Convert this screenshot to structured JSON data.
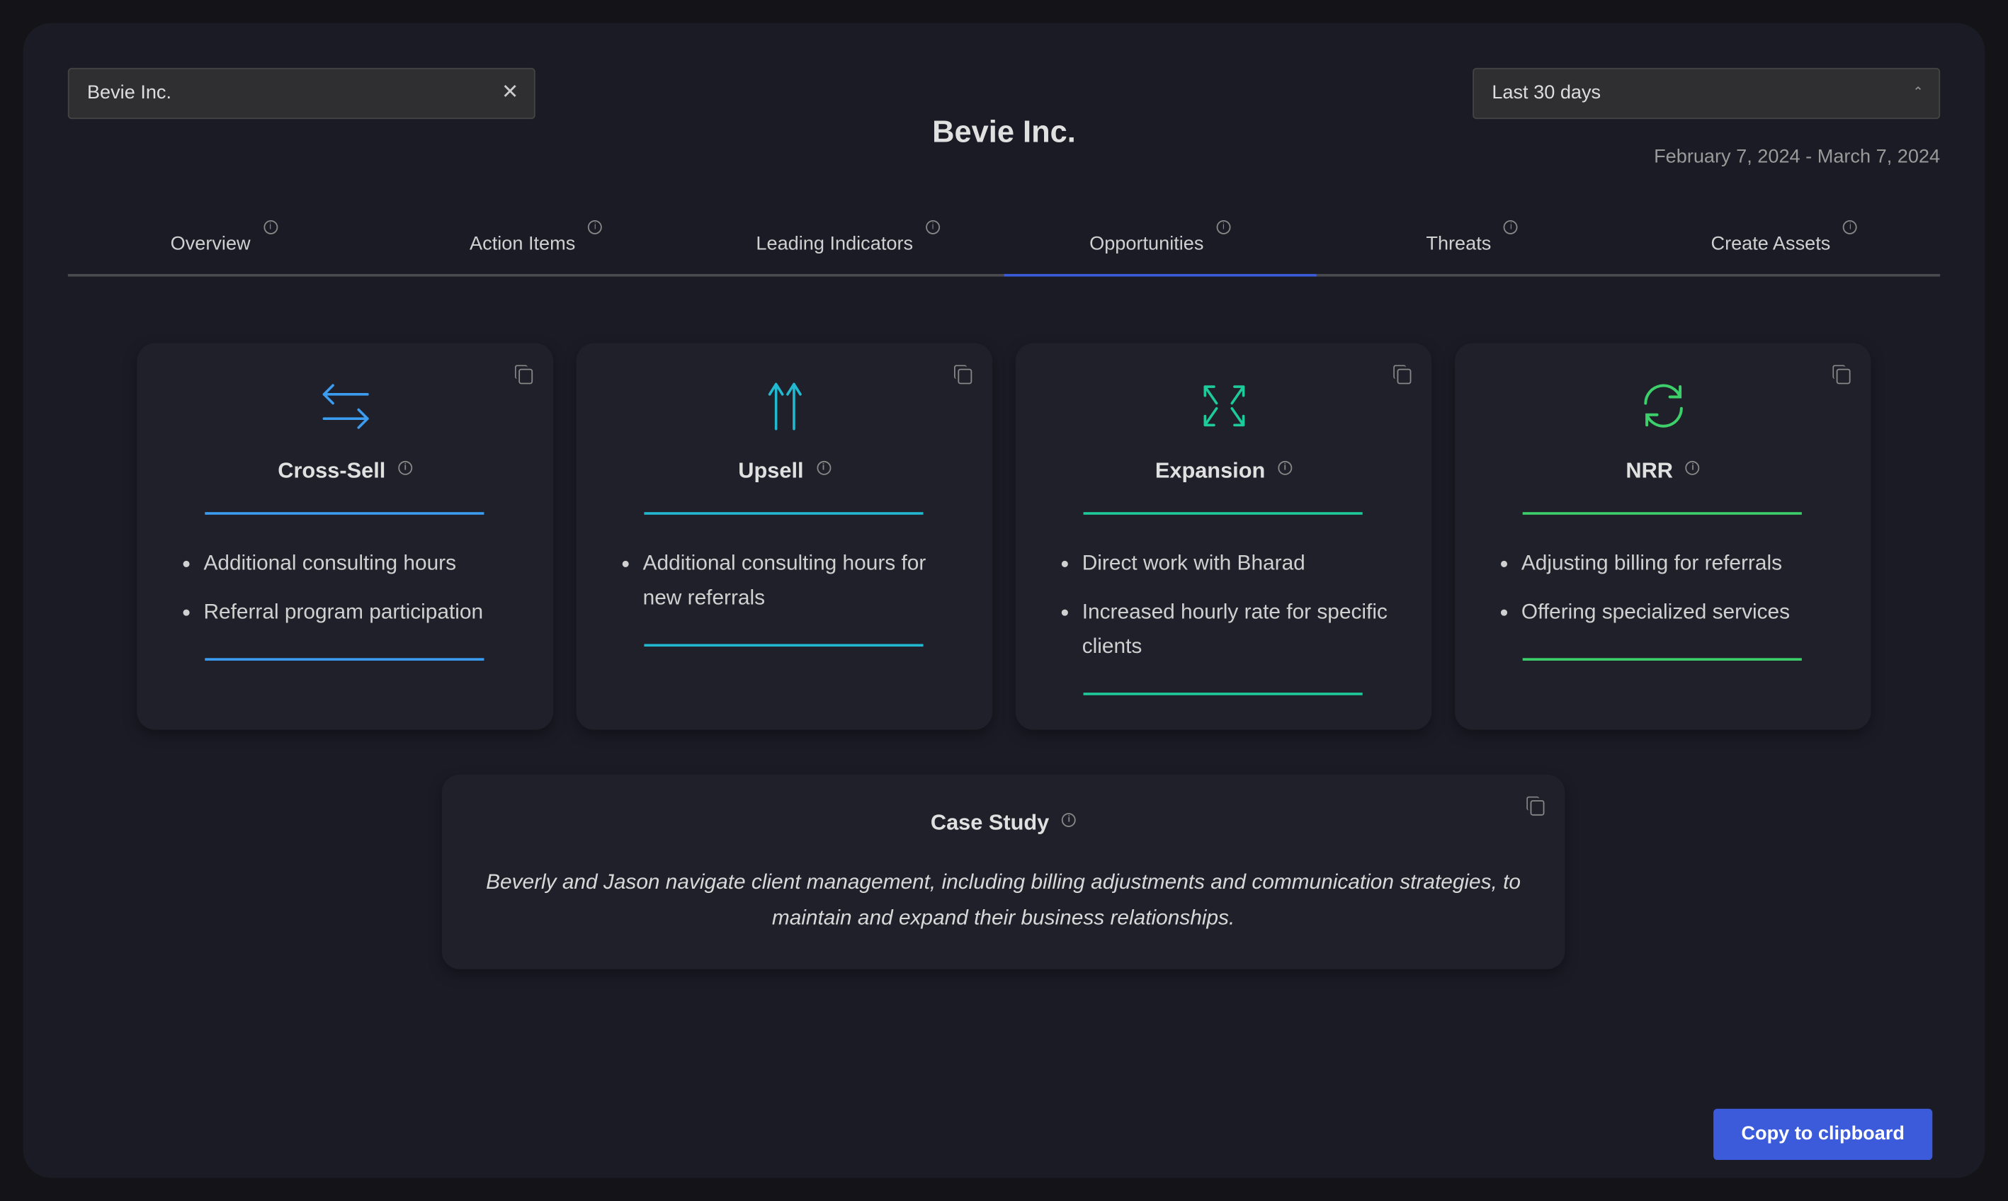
{
  "search": {
    "value": "Bevie Inc."
  },
  "date_range": {
    "selected": "Last 30 days",
    "dates": "February 7, 2024 - March 7, 2024"
  },
  "page_title": "Bevie Inc.",
  "tabs": [
    {
      "label": "Overview"
    },
    {
      "label": "Action Items"
    },
    {
      "label": "Leading Indicators"
    },
    {
      "label": "Opportunities",
      "active": true
    },
    {
      "label": "Threats"
    },
    {
      "label": "Create Assets"
    }
  ],
  "colors": {
    "cross_sell": "#3b9cf0",
    "upsell": "#22b8d0",
    "expansion": "#1ec99a",
    "nrr": "#3ccf6a",
    "accent": "#3b5bdb"
  },
  "cards": [
    {
      "title": "Cross-Sell",
      "icon": "arrows-left-right-icon",
      "items": [
        "Additional consulting hours",
        "Referral program participation"
      ]
    },
    {
      "title": "Upsell",
      "icon": "double-arrow-up-icon",
      "items": [
        "Additional consulting hours for new referrals"
      ]
    },
    {
      "title": "Expansion",
      "icon": "expand-arrows-icon",
      "items": [
        "Direct work with Bharad",
        "Increased hourly rate for specific clients"
      ]
    },
    {
      "title": "NRR",
      "icon": "refresh-icon",
      "items": [
        "Adjusting billing for referrals",
        "Offering specialized services"
      ]
    }
  ],
  "case_study": {
    "title": "Case Study",
    "body": "Beverly and Jason navigate client management, including billing adjustments and communication strategies, to maintain and expand their business relationships."
  },
  "copy_button": "Copy to clipboard"
}
